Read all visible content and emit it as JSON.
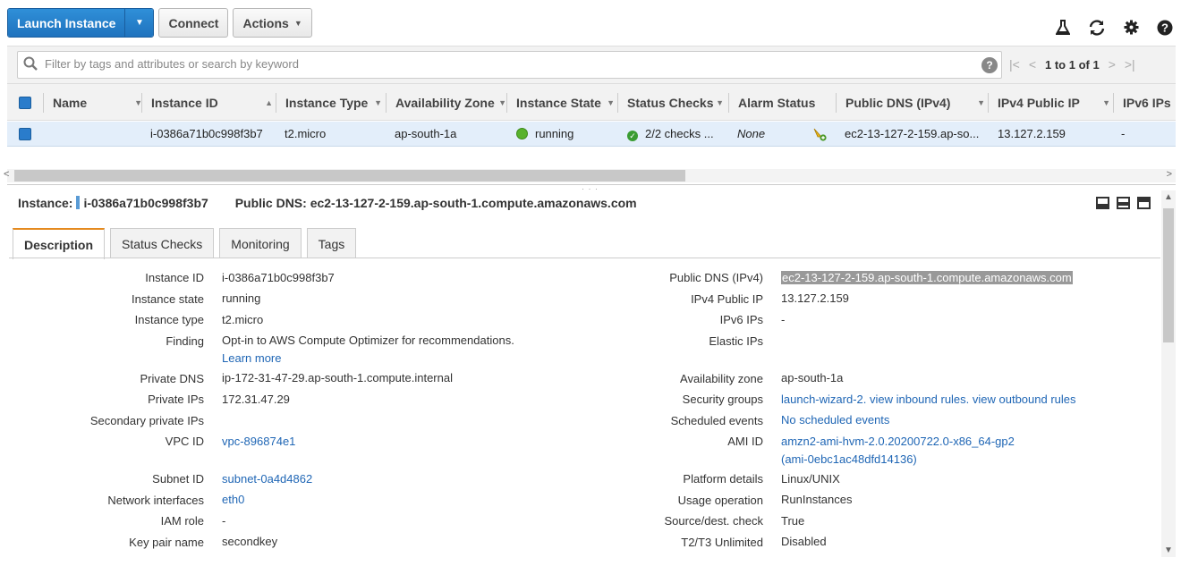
{
  "toolbar": {
    "launch_label": "Launch Instance",
    "connect_label": "Connect",
    "actions_label": "Actions"
  },
  "search": {
    "placeholder": "Filter by tags and attributes or search by keyword",
    "pagination": "1 to 1 of 1"
  },
  "table": {
    "columns": [
      "Name",
      "Instance ID",
      "Instance Type",
      "Availability Zone",
      "Instance State",
      "Status Checks",
      "Alarm Status",
      "Public DNS (IPv4)",
      "IPv4 Public IP",
      "IPv6 IPs"
    ],
    "row": {
      "name": "",
      "instance_id": "i-0386a71b0c998f3b7",
      "instance_type": "t2.micro",
      "availability_zone": "ap-south-1a",
      "instance_state": "running",
      "status_checks": "2/2 checks ...",
      "alarm_status": "None",
      "public_dns": "ec2-13-127-2-159.ap-so...",
      "ipv4_public_ip": "13.127.2.159",
      "ipv6_ips": "-"
    }
  },
  "details": {
    "instance_label": "Instance:",
    "instance_id": "i-0386a71b0c998f3b7",
    "public_dns_label": "Public DNS:",
    "public_dns": "ec2-13-127-2-159.ap-south-1.compute.amazonaws.com",
    "tabs": [
      "Description",
      "Status Checks",
      "Monitoring",
      "Tags"
    ],
    "left": [
      {
        "label": "Instance ID",
        "value": "i-0386a71b0c998f3b7"
      },
      {
        "label": "Instance state",
        "value": "running"
      },
      {
        "label": "Instance type",
        "value": "t2.micro"
      },
      {
        "label": "Finding",
        "value": "Opt-in to AWS Compute Optimizer for recommendations.",
        "link": "Learn more"
      },
      {
        "label": "Private DNS",
        "value": "ip-172-31-47-29.ap-south-1.compute.internal"
      },
      {
        "label": "Private IPs",
        "value": "172.31.47.29"
      },
      {
        "label": "Secondary private IPs",
        "value": ""
      },
      {
        "label": "VPC ID",
        "value": "vpc-896874e1"
      },
      {
        "label": "Subnet ID",
        "value": "subnet-0a4d4862"
      },
      {
        "label": "Network interfaces",
        "value": "eth0"
      },
      {
        "label": "IAM role",
        "value": "-"
      },
      {
        "label": "Key pair name",
        "value": "secondkey"
      }
    ],
    "right": [
      {
        "label": "Public DNS (IPv4)",
        "value": "ec2-13-127-2-159.ap-south-1.compute.amazonaws.com"
      },
      {
        "label": "IPv4 Public IP",
        "value": "13.127.2.159"
      },
      {
        "label": "IPv6 IPs",
        "value": "-"
      },
      {
        "label": "Elastic IPs",
        "value": ""
      },
      {
        "label": "Availability zone",
        "value": "ap-south-1a"
      },
      {
        "label": "Security groups",
        "value": "launch-wizard-2. view inbound rules. view outbound rules"
      },
      {
        "label": "Scheduled events",
        "value": "No scheduled events"
      },
      {
        "label": "AMI ID",
        "value": "amzn2-ami-hvm-2.0.20200722.0-x86_64-gp2",
        "value2": "(ami-0ebc1ac48dfd14136)"
      },
      {
        "label": "Platform details",
        "value": "Linux/UNIX"
      },
      {
        "label": "Usage operation",
        "value": "RunInstances"
      },
      {
        "label": "Source/dest. check",
        "value": "True"
      },
      {
        "label": "T2/T3 Unlimited",
        "value": "Disabled"
      }
    ]
  }
}
